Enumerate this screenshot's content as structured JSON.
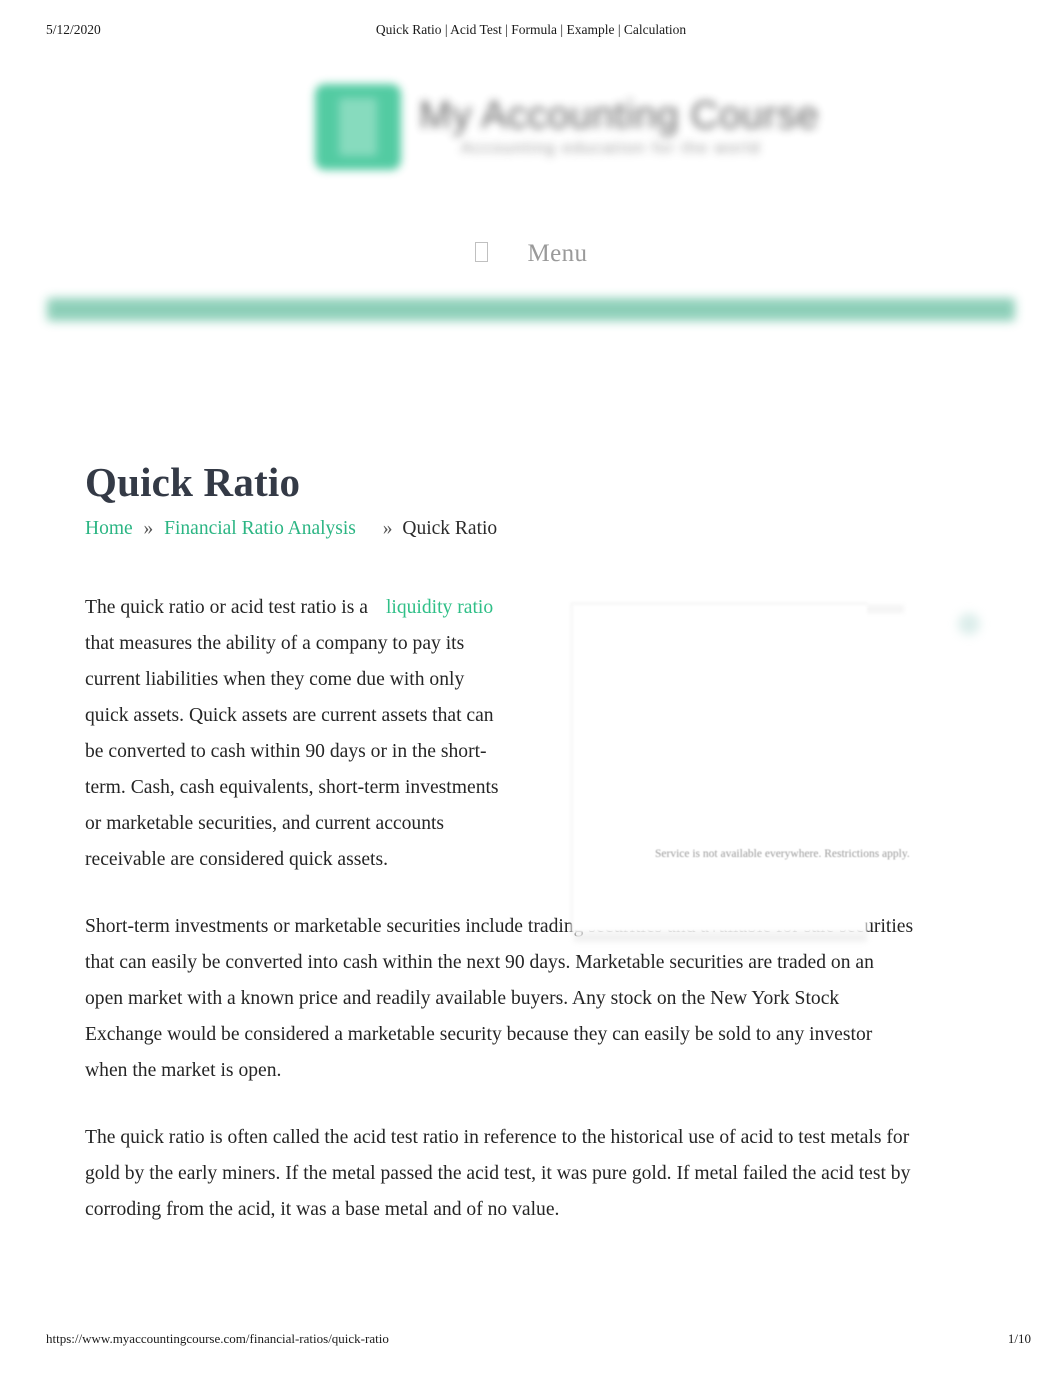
{
  "print_header": {
    "date": "5/12/2020",
    "document_title": "Quick Ratio | Acid Test | Formula | Example | Calculation"
  },
  "site_header": {
    "logo_mark_icon": "green-rounded-square-logo-icon",
    "logo_text": "My Accounting Course",
    "logo_tagline": "Accounting education for the world",
    "menu_icon": "hamburger-menu-icon",
    "menu_label": "Menu",
    "accent_color": "#45c79b",
    "divider_bar_color": "#87cdb5"
  },
  "page": {
    "title": "Quick Ratio"
  },
  "breadcrumb": {
    "items": [
      {
        "label": "Home",
        "is_link": true
      },
      {
        "label": "Financial Ratio Analysis",
        "is_link": true
      },
      {
        "label": "Quick Ratio",
        "is_link": false
      }
    ],
    "separator": "»",
    "link_color": "#2bb583"
  },
  "article": {
    "paragraph_1": {
      "text_before_link": "The quick ratio or acid test ratio is a",
      "link_text": "liquidity ratio",
      "text_after_link": " that measures the ability of a company to pay its current liabilities when they come due with only quick assets. Quick assets are current assets that can be converted to cash within 90 days or in the short-term. Cash, cash equivalents, short-term investments or marketable securities, and current accounts receivable are considered quick assets."
    },
    "paragraph_2": "Short-term investments or marketable securities include trading securities and available for sale securities that can easily be converted into cash within the next 90 days. Marketable securities are traded on an open market with a known price and readily available buyers. Any stock on the New York Stock Exchange would be considered a marketable security because they can easily be sold to any investor when the market is open.",
    "paragraph_3": "The quick ratio is often called the acid test ratio in reference to the historical use of acid to test metals for gold by the early miners. If the metal passed the acid test, it was pure gold. If metal failed the acid test by corroding from the acid, it was a base metal and of no value."
  },
  "advertisement": {
    "disclaimer": "Service is not available everywhere. Restrictions apply.",
    "badge_icon": "ad-choices-icon"
  },
  "print_footer": {
    "url": "https://www.myaccountingcourse.com/financial-ratios/quick-ratio",
    "page_number": "1/10"
  }
}
